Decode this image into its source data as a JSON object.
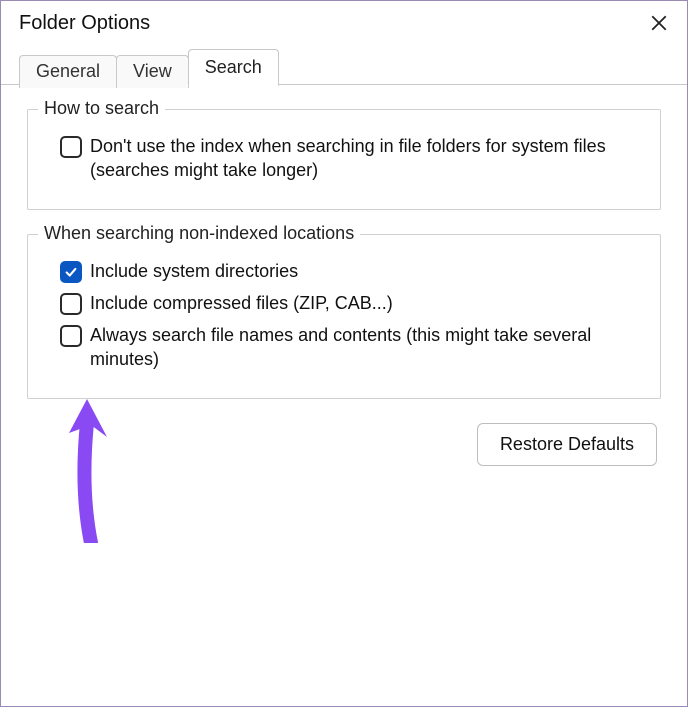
{
  "window": {
    "title": "Folder Options"
  },
  "tabs": {
    "general": "General",
    "view": "View",
    "search": "Search",
    "active": "search"
  },
  "groups": {
    "how_to_search": {
      "title": "How to search",
      "opt_index": {
        "label": "Don't use the index when searching in file folders for system files (searches might take longer)",
        "checked": false
      }
    },
    "non_indexed": {
      "title": "When searching non-indexed locations",
      "opt_sysdirs": {
        "label": "Include system directories",
        "checked": true
      },
      "opt_compressed": {
        "label": "Include compressed files (ZIP, CAB...)",
        "checked": false
      },
      "opt_contents": {
        "label": "Always search file names and contents (this might take several minutes)",
        "checked": false
      }
    }
  },
  "buttons": {
    "restore": "Restore Defaults"
  },
  "annotation": {
    "arrow_color": "#8a4af3"
  }
}
